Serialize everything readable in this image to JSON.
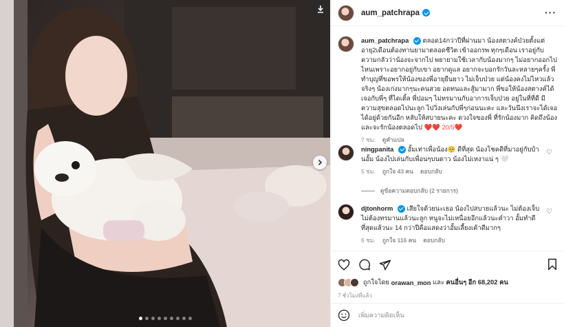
{
  "post": {
    "username": "aum_patchrapa",
    "image_dots": 9,
    "active_dot": 0
  },
  "caption": {
    "username": "aum_patchrapa",
    "text": "ตลอด14กว่าปีที่ผ่านมา น้องสตางค์ป่วยตั้งแต่อายุ2เดือนต้องทานยามาตลอดชีวิต เข้าออกรพ ทุกๆเดือน เราอยู่กับความกลัวว่าน้องจะจากไป พยายามใช้เวลากับน้องมากๆ ไม่อยากออกไปไหนเพราะอยากอยู่กับเขา อยากดูแล อยากจะบอกรักวันละหลายๆครั้ง พี่ทำบุญที่ขอพรให้น้องของพี่อายุยืนยาว ไม่เจ็บป่วย แต่น้องคงไม่ไหวแล้วจริงๆ น้องเก่งมากๆนะคนสวย อดทนและสู้มามาก พี่ขอให้น้องสตางค์ได้เจอกับพี่ๆ ที่ไดเติ้ล พี่ปอมๆ ไม่ทรมานกับอาการเจ็บป่วย อยู่ในที่ที่ดี มีความสุขตลอดไปนะลูก ไปวิ่งเล่นกับพี่ๆก่อนนะคะ และวันนึงเราจะได้เจอได้อยู่ด้วยกันอีก หลับให้สบายนะคะ ดวงใจของพี่ ที่รักน้องมาก คิดถึงน้อง และจะรักน้องตลอดไป",
    "hearts": "❤️❤️ 20/5❤️",
    "time": "7 ชม.",
    "see_translation": "ดูคำแปล"
  },
  "comments": [
    {
      "username": "ningpanita",
      "text": "อั้มเท่าเพื่อน้อง🥺 ดีที่สุด น้องโชคดีที่มาอยู่กับบ้านอั้ม น้องไปเล่นกับเพื่อนๆบนดาว น้องไม่เหงาแน่ ๆ 🤍",
      "time": "5 ชม.",
      "likes": "ถูกใจ 43 คน",
      "reply": "ตอบกลับ",
      "view_replies": "ดูข้อความตอบกลับ (2 รายการ)"
    },
    {
      "username": "djtonhorm",
      "text": "เสียใจด้วยนะเธอ น้องไปสบายแล้วนะ ไม่ต้องเจ็บไม่ต้องทรมานแล้วนะลูก หนูจะไม่เหนื่อยอีกแล้วนะคำวา อั้มทำดีที่สุดแล้วนะ 14 กว่าปีคือแสดงว่าอั้มเลี้ยงเค้าดีมากๆ",
      "time": "6 ชม.",
      "likes": "ถูกใจ 116 คน",
      "reply": "ตอบกลับ"
    }
  ],
  "likes": {
    "prefix": "ถูกใจโดย",
    "user": "orawan_mon",
    "mid": "และ",
    "others": "คนอื่นๆ อีก 68,202 คน"
  },
  "post_time": "7 ชั่วโมงที่แล้ว",
  "add_comment": {
    "placeholder": "เพิ่มความคิดเห็น"
  },
  "icons": {
    "download": "download-icon",
    "next": "chevron-right-icon",
    "more": "more-icon",
    "heart": "heart-icon",
    "comment": "comment-icon",
    "share": "share-icon",
    "save": "bookmark-icon",
    "emoji": "emoji-icon"
  },
  "colors": {
    "verified": "#0095f6",
    "heart": "#ed4956",
    "muted": "#8e8e8e"
  }
}
